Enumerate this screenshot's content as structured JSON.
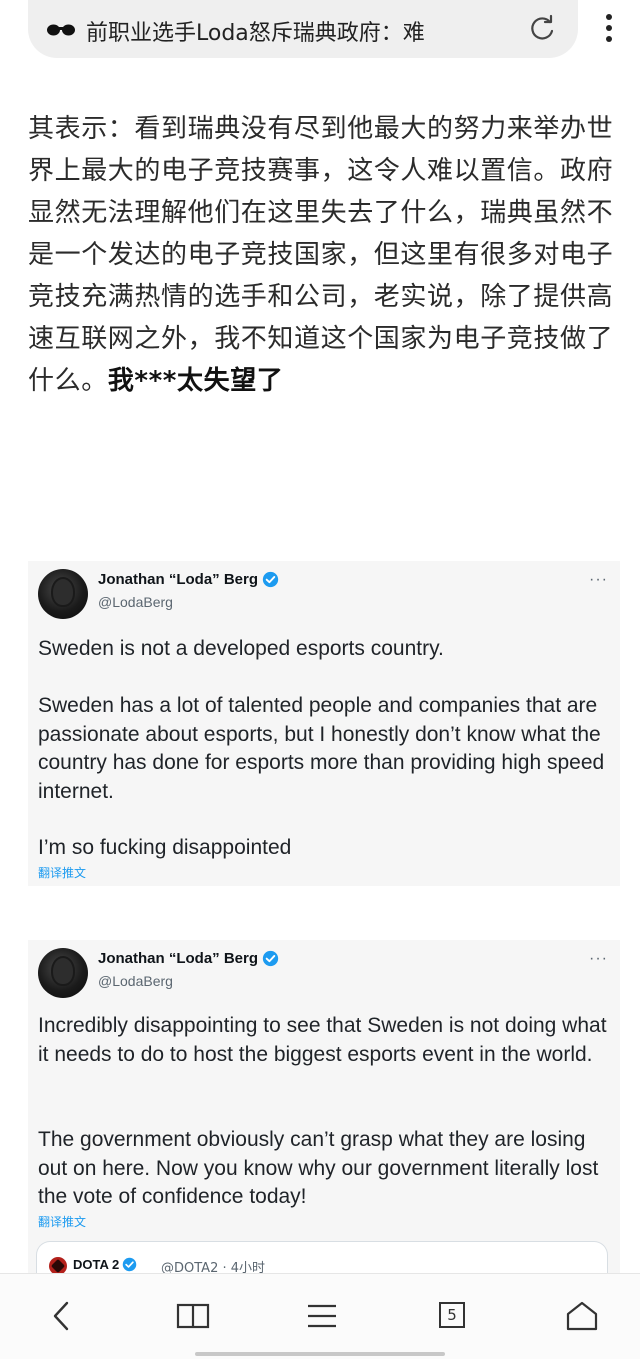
{
  "browser": {
    "page_title": "前职业选手Loda怒斥瑞典政府：难",
    "reload_icon": "reload-icon",
    "menu_icon": "kebab-menu-icon",
    "mode_icon": "incognito-glasses-icon"
  },
  "article": {
    "text": "其表示：看到瑞典没有尽到他最大的努力来举办世界上最大的电子竞技赛事，这令人难以置信。政府显然无法理解他们在这里失去了什么，瑞典虽然不是一个发达的电子竞技国家，但这里有很多对电子竞技充满热情的选手和公司，老实说，除了提供高速互联网之外，我不知道这个国家为电子竞技做了什么。",
    "emphasis": "我***太失望了"
  },
  "tweets": [
    {
      "name": "Jonathan “Loda” Berg",
      "handle": "@LodaBerg",
      "more": "···",
      "paragraphs": [
        "Sweden is not a developed esports country.",
        "Sweden has a lot of talented people and companies that are passionate about esports, but I honestly don’t know what the country has done for esports more than providing high speed internet.",
        "I’m so fucking disappointed"
      ],
      "translate": "翻译推文"
    },
    {
      "name": "Jonathan “Loda” Berg",
      "handle": "@LodaBerg",
      "more": "···",
      "paragraphs": [
        "Incredibly disappointing to see that Sweden is not doing what it needs to do to host the biggest esports event in the world.",
        "The government obviously can’t grasp what they are losing out on here. Now you know why our government literally lost the vote of confidence today!"
      ],
      "translate": "翻译推文",
      "quote": {
        "name": "DOTA 2",
        "meta": "@DOTA2 · 4小时"
      }
    }
  ],
  "bottom_nav": {
    "tab_count": "5",
    "items": [
      "back-icon",
      "reader-icon",
      "menu-icon",
      "tabs-icon",
      "home-icon"
    ]
  },
  "colors": {
    "accent": "#1d9bf0",
    "verified": "#1d9bf0",
    "card_bg": "#f6f6f6"
  }
}
